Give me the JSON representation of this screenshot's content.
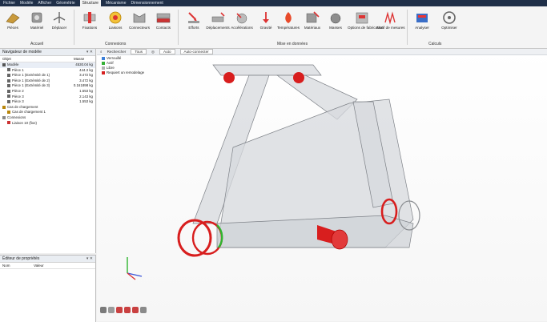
{
  "menu": [
    "Fichier",
    "Modèle",
    "Afficher",
    "Géométrie",
    "Structure",
    "Mécanisme",
    "Dimensionnement"
  ],
  "menu_active": "Structure",
  "ribbon": {
    "accueil": {
      "label": "Accueil",
      "buttons": [
        "Pièces",
        "Matériel",
        "Déplacer"
      ]
    },
    "connexions": {
      "label": "Connexions",
      "buttons": [
        "Fixations",
        "Liaisons",
        "Connecteurs",
        "Contacts"
      ]
    },
    "mise": {
      "label": "Mise en données",
      "buttons": [
        "Efforts",
        "Déplacements",
        "Accélérations",
        "Gravité",
        "Températures",
        "Matériaux",
        "Masses",
        "Options de fabrication",
        "Motif de mesures"
      ]
    },
    "calculs": {
      "label": "Calculs",
      "buttons": [
        "Analyser",
        "Optimiser"
      ]
    }
  },
  "model_browser": {
    "title": "Navigateur de modèle",
    "columns": [
      "Objet",
      "Masse"
    ],
    "rows": [
      {
        "name": "Modèle",
        "mass": "4530.04 kg",
        "indent": 0,
        "color": "#555"
      },
      {
        "name": "Pièce 1",
        "mass": "444.3 kg",
        "indent": 1,
        "color": "#666"
      },
      {
        "name": "Pièce 1 (Extrémité de 1)",
        "mass": "3.472 kg",
        "indent": 1,
        "color": "#666"
      },
      {
        "name": "Pièce 1 (Extrémité de 2)",
        "mass": "3.472 kg",
        "indent": 1,
        "color": "#666"
      },
      {
        "name": "Pièce 1 (Extrémité de 3)",
        "mass": "0.161898 kg",
        "indent": 1,
        "color": "#666"
      },
      {
        "name": "Pièce 2",
        "mass": "1.553 kg",
        "indent": 1,
        "color": "#666"
      },
      {
        "name": "Pièce 3",
        "mass": "2.143 kg",
        "indent": 1,
        "color": "#666"
      },
      {
        "name": "Pièce 3",
        "mass": "1.553 kg",
        "indent": 1,
        "color": "#666"
      },
      {
        "name": "Cas de chargement",
        "mass": "",
        "indent": 0,
        "color": "#b8860b"
      },
      {
        "name": "Cas de chargement 1",
        "mass": "",
        "indent": 1,
        "color": "#b8860b"
      },
      {
        "name": "Connexions",
        "mass": "",
        "indent": 0,
        "color": "#888"
      },
      {
        "name": "Liaison 10 (fixe)",
        "mass": "",
        "indent": 1,
        "color": "#c33"
      }
    ]
  },
  "property_editor": {
    "title": "Éditeur de propriétés",
    "columns": [
      "Nom",
      "Valeur"
    ]
  },
  "viewport": {
    "toolbar": [
      "Rechercher",
      "Tous",
      "Auto",
      "Auto-connecter"
    ],
    "legend": [
      {
        "label": "Verrouillé",
        "color": "#3b7fd9"
      },
      {
        "label": "Actif",
        "color": "#35b035"
      },
      {
        "label": "Libre",
        "color": "#b0b0b0"
      },
      {
        "label": "Requiert un remodelage",
        "color": "#d62020"
      }
    ]
  },
  "colors": {
    "highlight_red": "#d81e1e",
    "body_gray": "#d6d9dc",
    "accent_green": "#2fb52f"
  }
}
